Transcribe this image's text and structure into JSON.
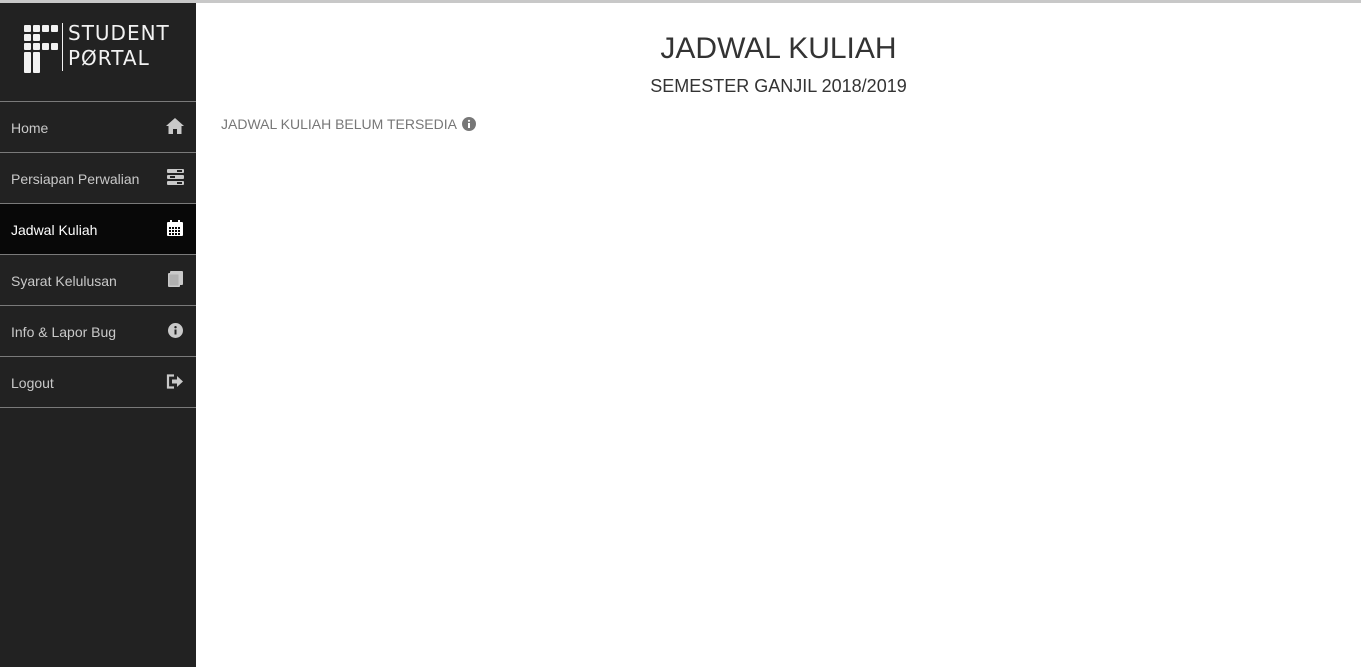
{
  "logo": {
    "line1": "STUDENT",
    "line2": "PØRTAL",
    "icon": "f-grid-logo-icon"
  },
  "sidebar": {
    "items": [
      {
        "label": "Home",
        "icon": "home-icon",
        "active": false
      },
      {
        "label": "Persiapan Perwalian",
        "icon": "list-icon",
        "active": false
      },
      {
        "label": "Jadwal Kuliah",
        "icon": "calendar-icon",
        "active": true
      },
      {
        "label": "Syarat Kelulusan",
        "icon": "book-icon",
        "active": false
      },
      {
        "label": "Info & Lapor Bug",
        "icon": "info-icon",
        "active": false
      },
      {
        "label": "Logout",
        "icon": "logout-icon",
        "active": false
      }
    ]
  },
  "main": {
    "title": "JADWAL KULIAH",
    "subtitle": "SEMESTER GANJIL 2018/2019",
    "notice": "JADWAL KULIAH BELUM TERSEDIA",
    "notice_icon": "info-circle-icon"
  },
  "colors": {
    "sidebar_bg": "#222222",
    "active_bg": "#080808",
    "nav_text": "#c9c9c9",
    "title_text": "#333333",
    "notice_text": "#777777"
  }
}
